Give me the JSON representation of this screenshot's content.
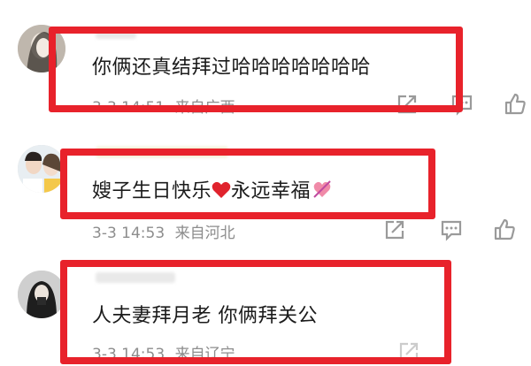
{
  "comments": [
    {
      "text": "你俩还真结拜过哈哈哈哈哈哈哈",
      "date": "3-3 14:51",
      "location": "来自广西"
    },
    {
      "text": "嫂子生日快乐",
      "text_after": "永远幸福",
      "date": "3-3 14:53",
      "location": "来自河北"
    },
    {
      "text": "人夫妻拜月老 你俩拜关公",
      "date": "3-3 14:53",
      "location": "来自辽宁"
    }
  ],
  "colors": {
    "highlight": "#e8222b",
    "meta_text": "#8d8d8d",
    "heart": "#e0232d"
  },
  "icons": [
    "share-icon",
    "comment-icon",
    "like-icon"
  ]
}
